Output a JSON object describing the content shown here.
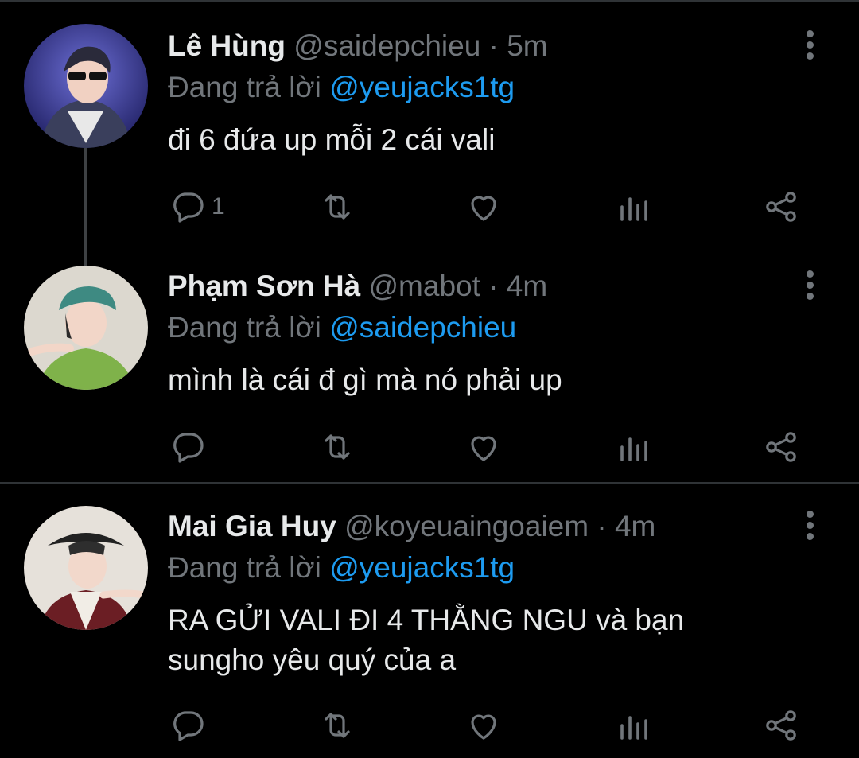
{
  "tweets": [
    {
      "name": "Lê Hùng",
      "handle": "@saidepchieu",
      "dot": "·",
      "time": "5m",
      "reply_prefix": "Đang trả lời",
      "reply_to": "@yeujacks1tg",
      "text": "đi 6 đứa up mỗi 2 cái vali",
      "reply_count": "1"
    },
    {
      "name": "Phạm Sơn Hà",
      "handle": "@mabot",
      "dot": "·",
      "time": "4m",
      "reply_prefix": "Đang trả lời",
      "reply_to": "@saidepchieu",
      "text": "mình là cái đ gì mà nó phải up",
      "reply_count": ""
    },
    {
      "name": "Mai Gia Huy",
      "handle": "@koyeuaingoaiem",
      "dot": "·",
      "time": "4m",
      "reply_prefix": "Đang trả lời",
      "reply_to": "@yeujacks1tg",
      "text_line1": "RA GỬI VALI ĐI 4 THẰNG NGU và bạn",
      "text_line2": "sungho yêu quý của a",
      "reply_count": ""
    }
  ],
  "icons": {
    "reply": "reply-icon",
    "retweet": "retweet-icon",
    "like": "heart-icon",
    "analytics": "analytics-icon",
    "share": "share-icon",
    "more": "more-vertical-icon"
  },
  "colors": {
    "background": "#000000",
    "text": "#e7e9ea",
    "muted": "#71767b",
    "link": "#1d9bf0",
    "divider": "#2f3336"
  }
}
